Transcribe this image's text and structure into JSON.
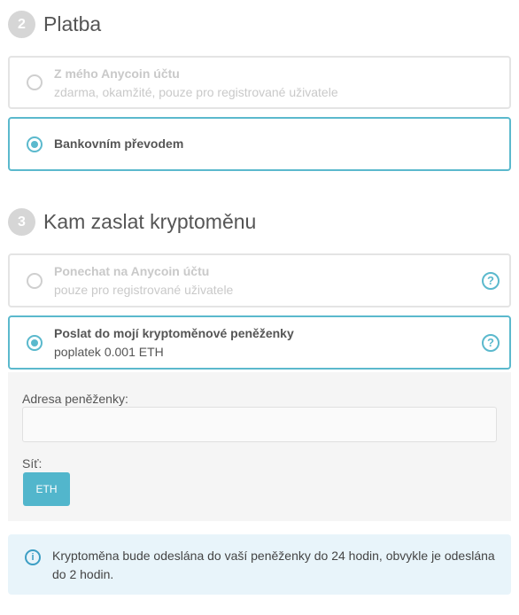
{
  "payment": {
    "step": "2",
    "title": "Platba",
    "options": [
      {
        "title": "Z mého Anycoin účtu",
        "subtitle": "zdarma, okamžité, pouze pro registrované uživatele",
        "selected": false
      },
      {
        "title": "Bankovním převodem",
        "subtitle": "",
        "selected": true
      }
    ]
  },
  "delivery": {
    "step": "3",
    "title": "Kam zaslat kryptoměnu",
    "options": [
      {
        "title": "Ponechat na Anycoin účtu",
        "subtitle": "pouze pro registrované uživatele",
        "selected": false,
        "help": "?"
      },
      {
        "title": "Poslat do mojí kryptoměnové peněženky",
        "subtitle": "poplatek 0.001 ETH",
        "selected": true,
        "help": "?"
      }
    ]
  },
  "wallet": {
    "address_label": "Adresa peněženky:",
    "address_value": "",
    "network_label": "Síť:",
    "network_button": "ETH"
  },
  "info": {
    "icon": "info-icon",
    "text": "Kryptoměna bude odeslána do vaší peněženky do 24 hodin, obvykle je odeslána do 2 hodin."
  },
  "colors": {
    "accent": "#5bb9cd",
    "step_circle": "#d6d6d6",
    "info_bg": "#e8f4fa"
  }
}
